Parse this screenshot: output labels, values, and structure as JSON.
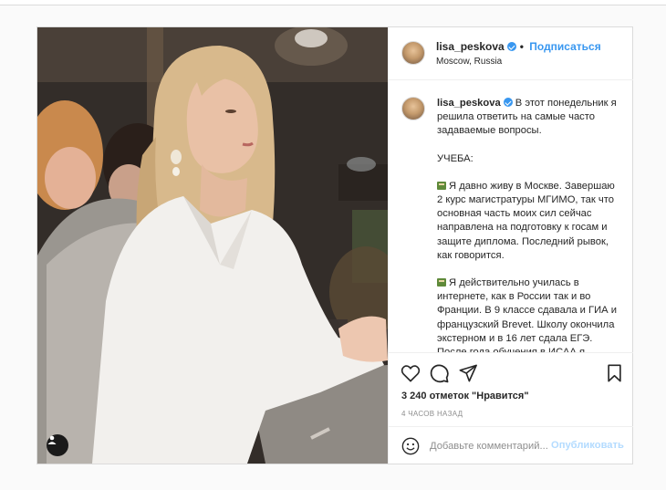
{
  "colors": {
    "accent": "#3897f0",
    "publish_disabled": "#b3dbff",
    "muted": "#8e8e8e",
    "border": "#dbdbdb"
  },
  "header": {
    "username": "lisa_peskova",
    "separator": "•",
    "follow_label": "Подписаться",
    "location": "Moscow, Russia",
    "verified_icon": "verified-badge-icon"
  },
  "caption": {
    "username": "lisa_peskova",
    "intro": "В этот понедельник я решила ответить на самые часто задаваемые вопросы.",
    "section_title": "УЧЕБА:",
    "paragraph_1": "Я давно живу в Москве. Завершаю 2 курс магистратуры МГИМО, так что основная часть моих сил сейчас направлена на подготовку к госам и защите диплома. Последний рывок, как говорится.",
    "paragraph_2": "Я действительно училась в интернете, как в России так и во Франции. В 9 классе сдавала и ГИА и французский Brevet. Школу окончила экстерном и в 16 лет сдала ЕГЭ. После года обучения в ИСАА я",
    "emoji_icon": "book-icon"
  },
  "actions": {
    "icons": [
      "heart-icon",
      "comment-icon",
      "share-icon",
      "bookmark-icon"
    ],
    "likes_text": "3 240 отметок \"Нравится\"",
    "time_text": "4 ЧАСОВ НАЗАД"
  },
  "comment_box": {
    "placeholder": "Добавьте комментарий...",
    "publish_label": "Опубликовать"
  },
  "media": {
    "tag_icon": "user-tag-icon"
  }
}
